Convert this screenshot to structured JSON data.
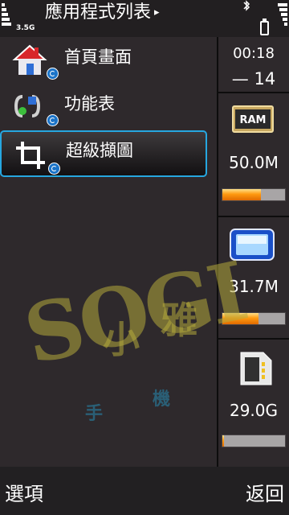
{
  "status": {
    "network_type": "3.5G",
    "title": "應用程式列表",
    "title_arrow": "▸",
    "bluetooth_icon": "bluetooth-icon",
    "battery_icon": "battery-icon"
  },
  "list": {
    "items": [
      {
        "label": "首頁畫面",
        "icon": "home-icon",
        "selected": false
      },
      {
        "label": "功能表",
        "icon": "menu-icon",
        "selected": false
      },
      {
        "label": "超級擷圖",
        "icon": "crop-icon",
        "selected": true
      }
    ]
  },
  "panel": {
    "clock_time": "00:18",
    "clock_date": "— 14",
    "widgets": [
      {
        "icon": "ram-chip-icon",
        "chip_label": "RAM",
        "value": "50.0M",
        "fill": 0.62
      },
      {
        "icon": "device-screen-icon",
        "value": "31.7M",
        "fill": 0.58
      },
      {
        "icon": "memory-card-icon",
        "value": "29.0G",
        "fill": 0.03
      }
    ]
  },
  "watermark": {
    "main": "SOGI",
    "chars": [
      "小",
      "雅",
      "手",
      "機"
    ]
  },
  "softkeys": {
    "left": "選項",
    "right": "返回"
  },
  "colors": {
    "background": "#2e292c",
    "selection_border": "#26a7e0",
    "meter_fill": "#ff9a10"
  }
}
